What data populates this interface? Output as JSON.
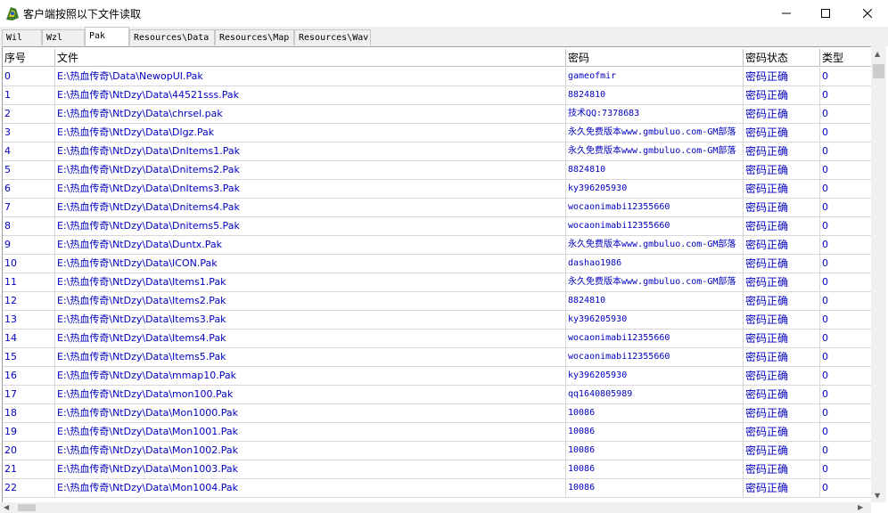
{
  "window": {
    "title": "客户端按照以下文件读取"
  },
  "tabs": [
    {
      "label": "Wil"
    },
    {
      "label": "Wzl"
    },
    {
      "label": "Pak"
    },
    {
      "label": "Resources\\Data"
    },
    {
      "label": "Resources\\Map"
    },
    {
      "label": "Resources\\Wav"
    }
  ],
  "columns": {
    "index": "序号",
    "file": "文件",
    "password": "密码",
    "status": "密码状态",
    "type": "类型"
  },
  "rows": [
    {
      "index": "0",
      "file": "E:\\热血传奇\\Data\\NewopUI.Pak",
      "password": "gameofmir",
      "status": "密码正确",
      "type": "0"
    },
    {
      "index": "1",
      "file": "E:\\热血传奇\\NtDzy\\Data\\44521sss.Pak",
      "password": "8824810",
      "status": "密码正确",
      "type": "0"
    },
    {
      "index": "2",
      "file": "E:\\热血传奇\\NtDzy\\Data\\chrsel.pak",
      "password": "技术QQ:7378683",
      "status": "密码正确",
      "type": "0"
    },
    {
      "index": "3",
      "file": "E:\\热血传奇\\NtDzy\\Data\\Dlgz.Pak",
      "password": "永久免费版本www.gmbuluo.com-GM部落",
      "status": "密码正确",
      "type": "0"
    },
    {
      "index": "4",
      "file": "E:\\热血传奇\\NtDzy\\Data\\DnItems1.Pak",
      "password": "永久免费版本www.gmbuluo.com-GM部落",
      "status": "密码正确",
      "type": "0"
    },
    {
      "index": "5",
      "file": "E:\\热血传奇\\NtDzy\\Data\\Dnitems2.Pak",
      "password": "8824810",
      "status": "密码正确",
      "type": "0"
    },
    {
      "index": "6",
      "file": "E:\\热血传奇\\NtDzy\\Data\\DnItems3.Pak",
      "password": "ky396205930",
      "status": "密码正确",
      "type": "0"
    },
    {
      "index": "7",
      "file": "E:\\热血传奇\\NtDzy\\Data\\Dnitems4.Pak",
      "password": "wocaonimabi12355660",
      "status": "密码正确",
      "type": "0"
    },
    {
      "index": "8",
      "file": "E:\\热血传奇\\NtDzy\\Data\\Dnitems5.Pak",
      "password": "wocaonimabi12355660",
      "status": "密码正确",
      "type": "0"
    },
    {
      "index": "9",
      "file": "E:\\热血传奇\\NtDzy\\Data\\Duntx.Pak",
      "password": "永久免费版本www.gmbuluo.com-GM部落",
      "status": "密码正确",
      "type": "0"
    },
    {
      "index": "10",
      "file": "E:\\热血传奇\\NtDzy\\Data\\ICON.Pak",
      "password": "dashao1986",
      "status": "密码正确",
      "type": "0"
    },
    {
      "index": "11",
      "file": "E:\\热血传奇\\NtDzy\\Data\\Items1.Pak",
      "password": "永久免费版本www.gmbuluo.com-GM部落",
      "status": "密码正确",
      "type": "0"
    },
    {
      "index": "12",
      "file": "E:\\热血传奇\\NtDzy\\Data\\Items2.Pak",
      "password": "8824810",
      "status": "密码正确",
      "type": "0"
    },
    {
      "index": "13",
      "file": "E:\\热血传奇\\NtDzy\\Data\\Items3.Pak",
      "password": "ky396205930",
      "status": "密码正确",
      "type": "0"
    },
    {
      "index": "14",
      "file": "E:\\热血传奇\\NtDzy\\Data\\Items4.Pak",
      "password": "wocaonimabi12355660",
      "status": "密码正确",
      "type": "0"
    },
    {
      "index": "15",
      "file": "E:\\热血传奇\\NtDzy\\Data\\Items5.Pak",
      "password": "wocaonimabi12355660",
      "status": "密码正确",
      "type": "0"
    },
    {
      "index": "16",
      "file": "E:\\热血传奇\\NtDzy\\Data\\mmap10.Pak",
      "password": "ky396205930",
      "status": "密码正确",
      "type": "0"
    },
    {
      "index": "17",
      "file": "E:\\热血传奇\\NtDzy\\Data\\mon100.Pak",
      "password": "qq1640805989",
      "status": "密码正确",
      "type": "0"
    },
    {
      "index": "18",
      "file": "E:\\热血传奇\\NtDzy\\Data\\Mon1000.Pak",
      "password": "10086",
      "status": "密码正确",
      "type": "0"
    },
    {
      "index": "19",
      "file": "E:\\热血传奇\\NtDzy\\Data\\Mon1001.Pak",
      "password": "10086",
      "status": "密码正确",
      "type": "0"
    },
    {
      "index": "20",
      "file": "E:\\热血传奇\\NtDzy\\Data\\Mon1002.Pak",
      "password": "10086",
      "status": "密码正确",
      "type": "0"
    },
    {
      "index": "21",
      "file": "E:\\热血传奇\\NtDzy\\Data\\Mon1003.Pak",
      "password": "10086",
      "status": "密码正确",
      "type": "0"
    },
    {
      "index": "22",
      "file": "E:\\热血传奇\\NtDzy\\Data\\Mon1004.Pak",
      "password": "10086",
      "status": "密码正确",
      "type": "0"
    }
  ],
  "colors": {
    "text_link": "#0000c0",
    "tab_bg": "#f0f0f0"
  }
}
